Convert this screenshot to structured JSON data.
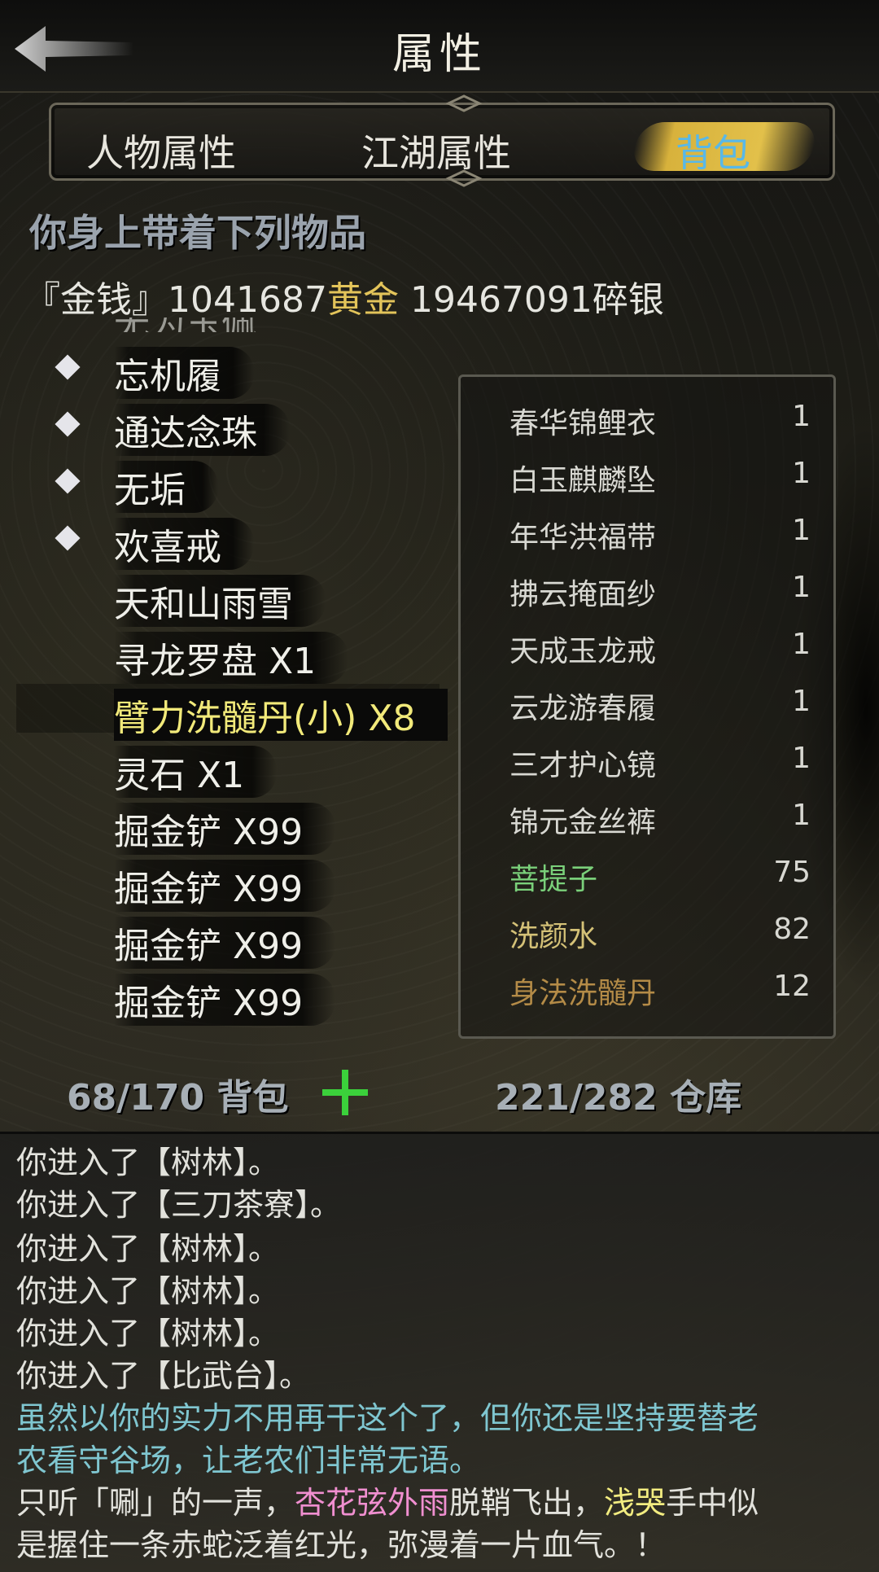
{
  "header": {
    "title": "属性"
  },
  "tabs": [
    {
      "label": "人物属性"
    },
    {
      "label": "江湖属性"
    },
    {
      "label": "背包"
    }
  ],
  "section_title": "你身上带着下列物品",
  "money": {
    "prefix": "『金钱』",
    "gold_amount": "1041687",
    "gold_label": "黄金",
    "silver_amount": " 19467091",
    "silver_label": "碎银"
  },
  "partial_item": "无为玉佩",
  "inventory": [
    {
      "name": "忘机履",
      "equipped": true
    },
    {
      "name": "通达念珠",
      "equipped": true
    },
    {
      "name": "无垢",
      "equipped": true
    },
    {
      "name": "欢喜戒",
      "equipped": true
    },
    {
      "name": "天和山雨雪",
      "equipped": false
    },
    {
      "name": "寻龙罗盘 X1",
      "equipped": false
    },
    {
      "name": "臂力洗髓丹(小) X8",
      "equipped": false,
      "highlight": true
    },
    {
      "name": "灵石 X1",
      "equipped": false
    },
    {
      "name": "掘金铲 X99",
      "equipped": false
    },
    {
      "name": "掘金铲 X99",
      "equipped": false
    },
    {
      "name": "掘金铲 X99",
      "equipped": false
    },
    {
      "name": "掘金铲 X99",
      "equipped": false
    }
  ],
  "stash": [
    {
      "name": "春华锦鲤衣",
      "qty": "1"
    },
    {
      "name": "白玉麒麟坠",
      "qty": "1"
    },
    {
      "name": "年华洪福带",
      "qty": "1"
    },
    {
      "name": "拂云掩面纱",
      "qty": "1"
    },
    {
      "name": "天成玉龙戒",
      "qty": "1"
    },
    {
      "name": "云龙游春履",
      "qty": "1"
    },
    {
      "name": "三才护心镜",
      "qty": "1"
    },
    {
      "name": "锦元金丝裤",
      "qty": "1"
    },
    {
      "name": "菩提子",
      "qty": "75",
      "color": "green"
    },
    {
      "name": "洗颜水",
      "qty": "82",
      "color": "khaki"
    },
    {
      "name": "身法洗髓丹",
      "qty": "12",
      "color": "brown"
    }
  ],
  "capacity": {
    "bag": "68/170 背包",
    "storage": "221/282 仓库"
  },
  "log": [
    "你进入了【树林】。",
    "你进入了【三刀茶寮】。",
    "你进入了【树林】。",
    "你进入了【树林】。",
    "你进入了【树林】。",
    "你进入了【比武台】。"
  ],
  "log_system": {
    "line1": "虽然以你的实力不用再干这个了，但你还是坚持要替老",
    "line2": "农看守谷场，让老农们非常无语。"
  },
  "log_combat": {
    "line1_a": "只听「唰」的一声，",
    "line1_weapon": "杏花弦外雨",
    "line1_b": "脱鞘飞出，",
    "line1_name": "浅哭",
    "line1_c": "手中似",
    "line2": "是握住一条赤蛇泛着红光，弥漫着一片血气。！"
  },
  "colors": {
    "active_tab": "#58b8e8",
    "gold": "#e3c45a",
    "highlight_item": "#f2ea7a",
    "green_item": "#7ad07a",
    "system_msg": "#7fc6d0",
    "weapon_name": "#f08fd0",
    "player_name": "#f2ec80",
    "add_button": "#3bd13b"
  }
}
